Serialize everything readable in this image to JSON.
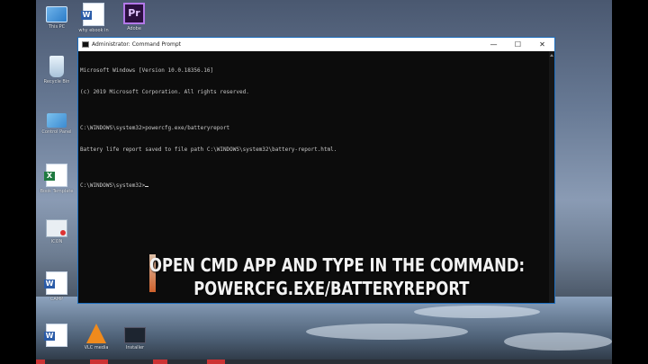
{
  "desktop": {
    "icons": [
      {
        "id": "this-pc",
        "label": "This PC",
        "icon": "computer-icon"
      },
      {
        "id": "why-ebook",
        "label": "why ebook in",
        "icon": "word-doc-icon"
      },
      {
        "id": "adobe",
        "label": "Adobe",
        "icon": "premiere-icon",
        "glyph": "Pr"
      },
      {
        "id": "recycle-bin",
        "label": "Recycle Bin",
        "icon": "recycle-bin-icon"
      },
      {
        "id": "control-panel",
        "label": "Control Panel",
        "icon": "control-panel-icon"
      },
      {
        "id": "excel-file",
        "label": "Book Template",
        "icon": "excel-icon",
        "glyph": "X"
      },
      {
        "id": "shortcut",
        "label": "ICON",
        "icon": "shortcut-icon"
      },
      {
        "id": "word-file",
        "label": "CAMP",
        "icon": "word-doc-icon",
        "glyph": "W"
      },
      {
        "id": "vlc",
        "label": "VLC media",
        "icon": "vlc-icon"
      },
      {
        "id": "terminal",
        "label": "Installer",
        "icon": "terminal-icon"
      }
    ]
  },
  "cmd_window": {
    "title": "Administrator: Command Prompt",
    "buttons": {
      "minimize": "—",
      "maximize": "☐",
      "close": "✕"
    },
    "lines": [
      "Microsoft Windows [Version 10.0.18356.16]",
      "(c) 2019 Microsoft Corporation. All rights reserved.",
      "",
      "C:\\WINDOWS\\system32>powercfg.exe/batteryreport",
      "Battery life report saved to file path C:\\WINDOWS\\system32\\battery-report.html.",
      "",
      "C:\\WINDOWS\\system32>"
    ]
  },
  "caption": {
    "line1": "Open CMD app and type in the command:",
    "line2": "powercfg.exe/batteryreport"
  },
  "colors": {
    "console_bg": "#0c0c0c",
    "console_text": "#c8c8c8",
    "window_border": "#1e6fbf",
    "caption_accent": "#e46a2f"
  }
}
